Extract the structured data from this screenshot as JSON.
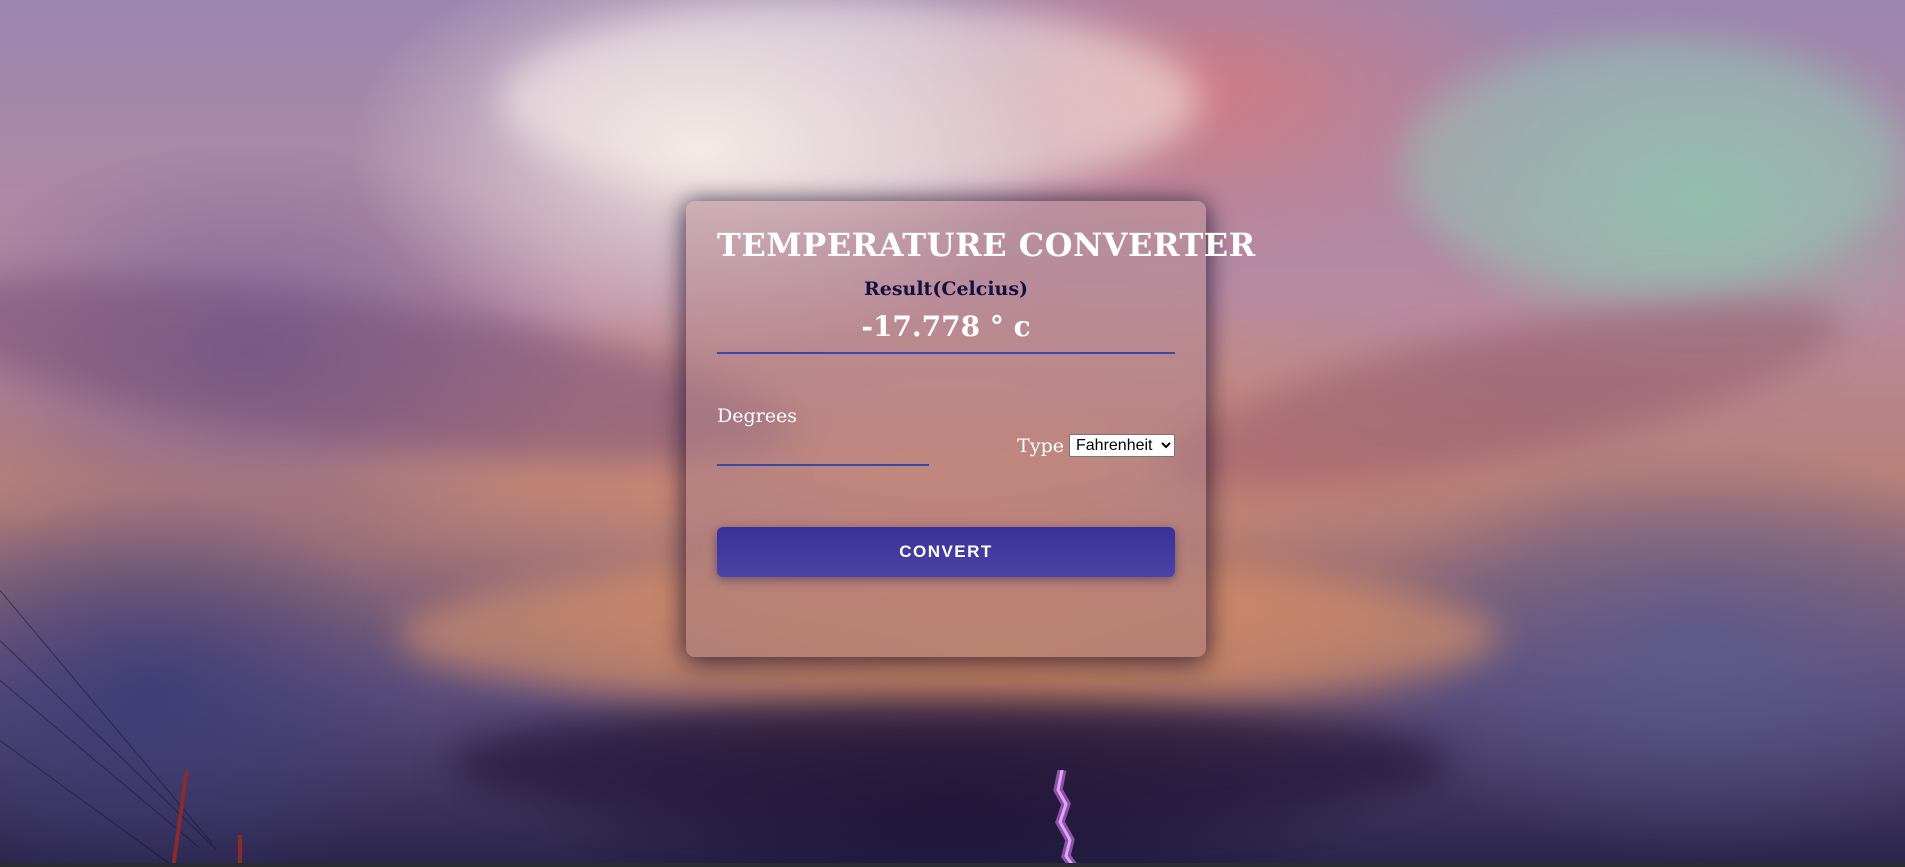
{
  "app": {
    "title": "TEMPERATURE CONVERTER"
  },
  "result": {
    "label": "Result(Celcius)",
    "value": "-17.778 ° c"
  },
  "form": {
    "degrees_label": "Degrees",
    "degrees_value": "",
    "type_label": "Type",
    "type_selected": "Fahrenheit",
    "convert_label": "CONVERT"
  },
  "colors": {
    "accent_line": "#3949ab",
    "button": "#3f3a9e",
    "result_label": "#151040"
  }
}
